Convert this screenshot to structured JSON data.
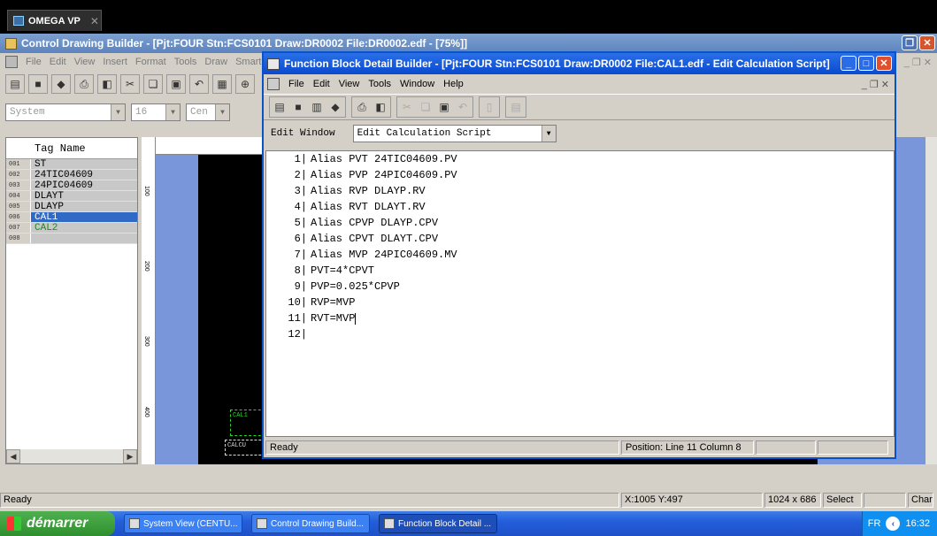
{
  "omega_tab": {
    "label": "OMEGA VP"
  },
  "cdb": {
    "title": "Control Drawing Builder - [Pjt:FOUR Stn:FCS0101 Draw:DR0002 File:DR0002.edf - [75%]]",
    "menu": [
      "File",
      "Edit",
      "View",
      "Insert",
      "Format",
      "Tools",
      "Draw",
      "Smart-f"
    ],
    "combo_system": "System",
    "combo_size": "16",
    "combo_center": "Cen",
    "tag_header": "Tag Name",
    "tags": [
      {
        "num": "001",
        "name": "ST"
      },
      {
        "num": "002",
        "name": "24TIC04609"
      },
      {
        "num": "003",
        "name": "24PIC04609"
      },
      {
        "num": "004",
        "name": "DLAYT"
      },
      {
        "num": "005",
        "name": "DLAYP"
      },
      {
        "num": "006",
        "name": "CAL1"
      },
      {
        "num": "007",
        "name": "CAL2"
      },
      {
        "num": "008",
        "name": ""
      }
    ],
    "ruler_marks": [
      "100",
      "200",
      "300",
      "400"
    ],
    "cal_labels": [
      "CAL1",
      "CALCU"
    ],
    "status": {
      "ready": "Ready",
      "coords": "X:1005 Y:497",
      "resolution": "1024 x 686",
      "mode": "Select",
      "change": "Change"
    }
  },
  "fbd": {
    "title": "Function Block Detail Builder - [Pjt:FOUR Stn:FCS0101 Draw:DR0002 File:CAL1.edf - Edit Calculation Script]",
    "menu": [
      "File",
      "Edit",
      "View",
      "Tools",
      "Window",
      "Help"
    ],
    "edit_window_label": "Edit Window",
    "edit_window_value": "Edit Calculation Script",
    "script_lines": [
      {
        "ln": "1",
        "text": "Alias PVT 24TIC04609.PV"
      },
      {
        "ln": "2",
        "text": "Alias PVP 24PIC04609.PV"
      },
      {
        "ln": "3",
        "text": "Alias RVP DLAYP.RV"
      },
      {
        "ln": "4",
        "text": "Alias RVT DLAYT.RV"
      },
      {
        "ln": "5",
        "text": "Alias CPVP DLAYP.CPV"
      },
      {
        "ln": "6",
        "text": "Alias CPVT DLAYT.CPV"
      },
      {
        "ln": "7",
        "text": "Alias MVP 24PIC04609.MV"
      },
      {
        "ln": "8",
        "text": "PVT=4*CPVT"
      },
      {
        "ln": "9",
        "text": "PVP=0.025*CPVP"
      },
      {
        "ln": "10",
        "text": "RVP=MVP"
      },
      {
        "ln": "11",
        "text": "RVT=MVP"
      },
      {
        "ln": "12",
        "text": ""
      }
    ],
    "status_ready": "Ready",
    "status_position": "Position: Line  11 Column  8"
  },
  "taskbar": {
    "start": "démarrer",
    "tasks": [
      "System View (CENTU...",
      "Control Drawing Build...",
      "Function Block Detail ..."
    ],
    "lang": "FR",
    "clock": "16:32"
  }
}
